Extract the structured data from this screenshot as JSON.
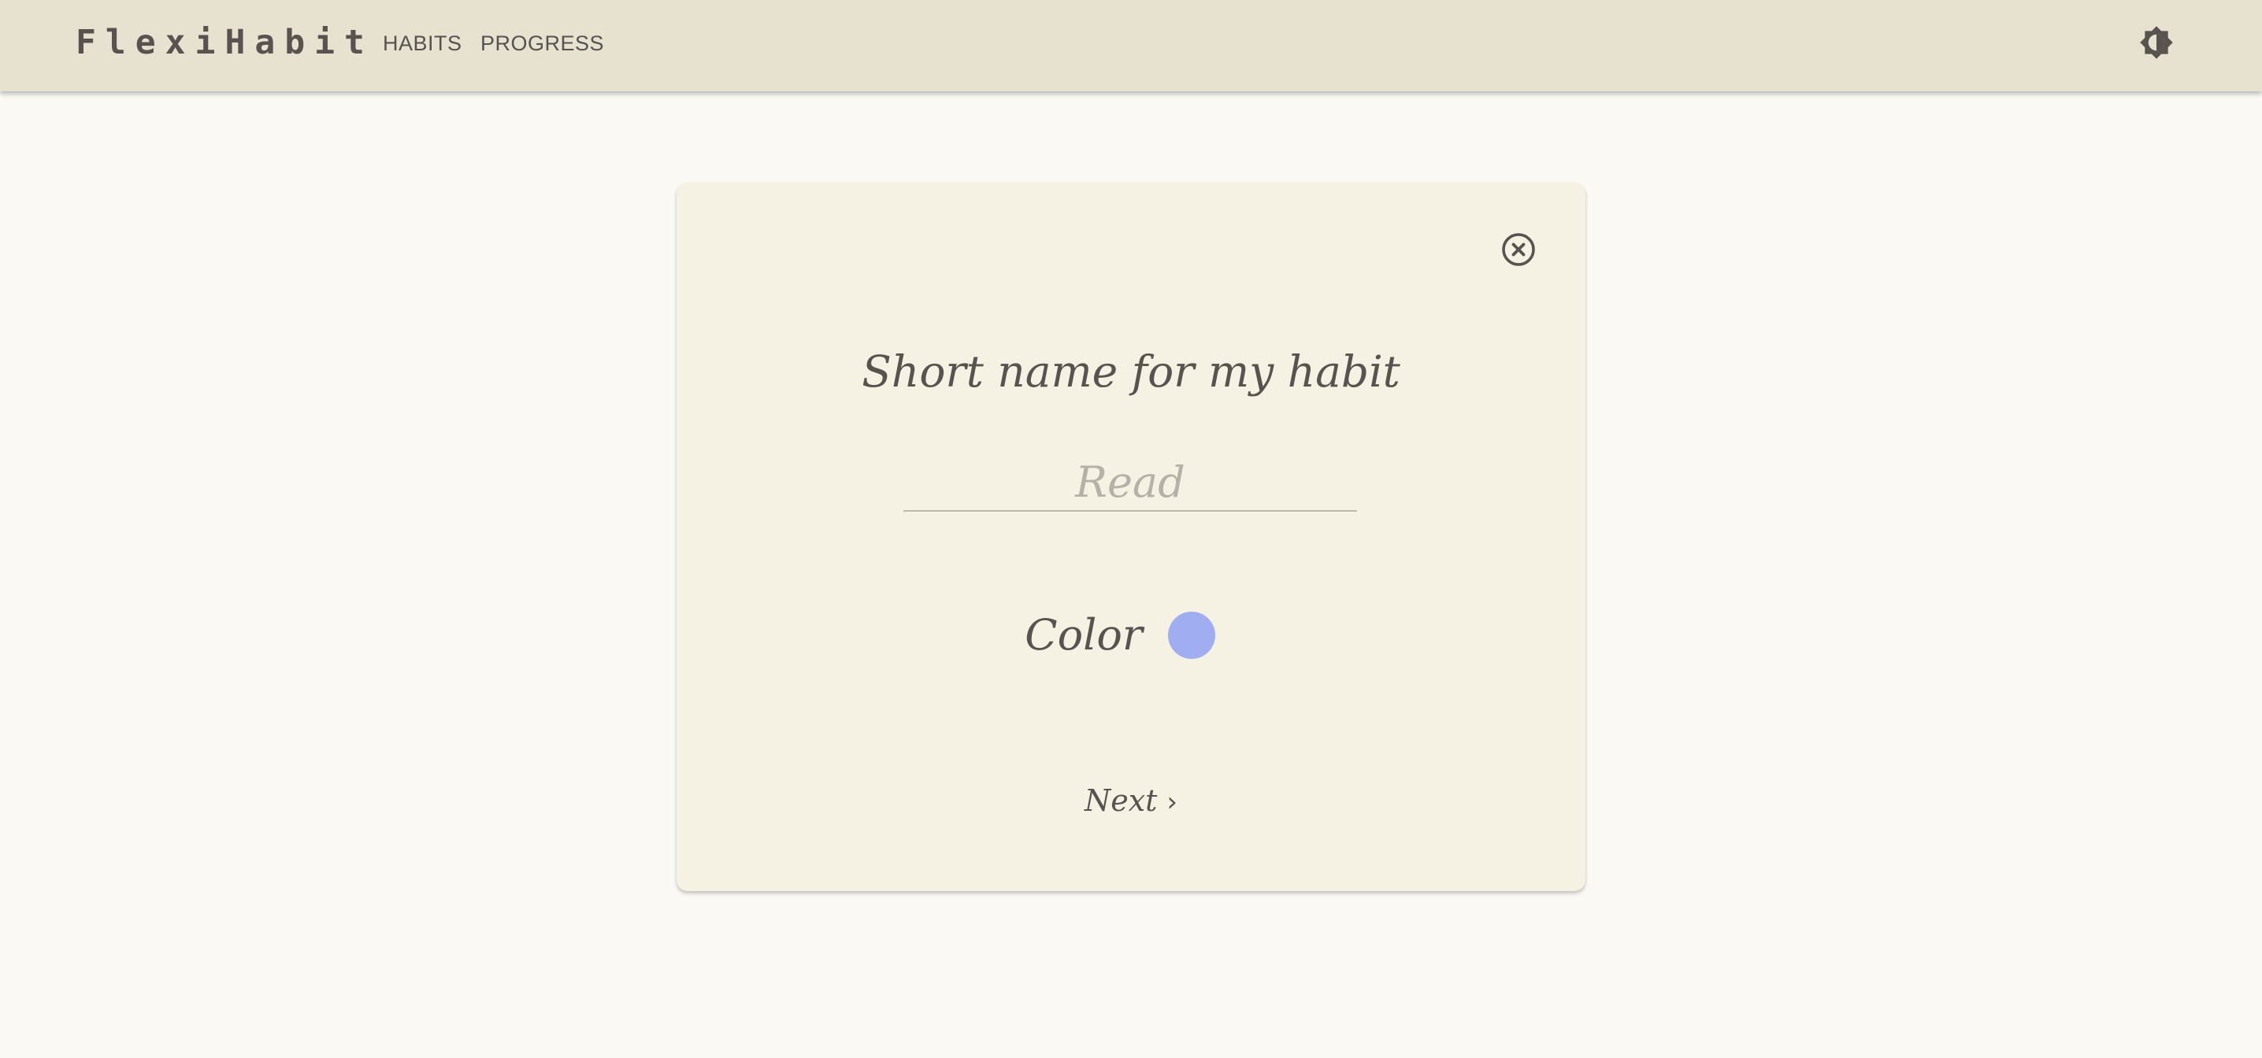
{
  "navbar": {
    "brand": "FlexiHabit",
    "links": [
      {
        "label": "HABITS"
      },
      {
        "label": "PROGRESS"
      }
    ],
    "theme_toggle_icon": "brightness-icon"
  },
  "dialog": {
    "close_icon": "close-circle-icon",
    "heading": "Short name for my habit",
    "name_input": {
      "value": "",
      "placeholder": "Read"
    },
    "color_label": "Color",
    "selected_color": "#a1adf1",
    "next_label": "Next",
    "next_icon": "chevron-right-icon"
  },
  "colors": {
    "page_background": "#faf9f4",
    "navbar_background": "#e6e2cf",
    "card_background": "#f5f2e4",
    "text": "#58534f"
  }
}
